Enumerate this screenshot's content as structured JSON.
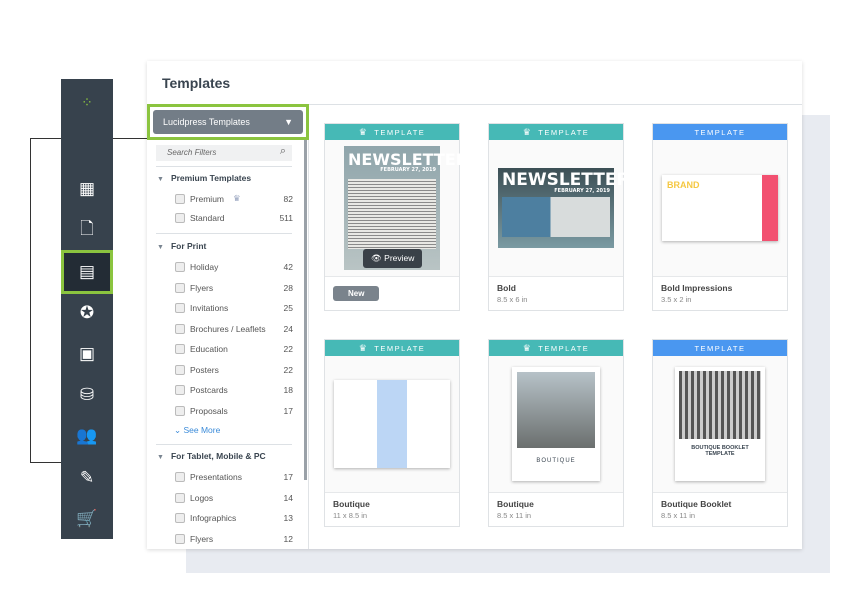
{
  "header": {
    "title": "Templates"
  },
  "dropdown": {
    "value": "Lucidpress Templates"
  },
  "search": {
    "placeholder": "Search Filters"
  },
  "sidebar": {
    "icons": [
      "logo-icon",
      "dashboard-icon",
      "document-icon",
      "templates-icon",
      "star-icon",
      "image-icon",
      "database-icon",
      "users-icon",
      "user-edit-icon",
      "cart-icon"
    ],
    "active": "templates-icon"
  },
  "filters": {
    "premium": {
      "title": "Premium Templates",
      "items": [
        {
          "label": "Premium",
          "count": "82"
        },
        {
          "label": "Standard",
          "count": "511"
        }
      ]
    },
    "print": {
      "title": "For Print",
      "items": [
        {
          "label": "Holiday",
          "count": "42"
        },
        {
          "label": "Flyers",
          "count": "28"
        },
        {
          "label": "Invitations",
          "count": "25"
        },
        {
          "label": "Brochures / Leaflets",
          "count": "24"
        },
        {
          "label": "Education",
          "count": "22"
        },
        {
          "label": "Posters",
          "count": "22"
        },
        {
          "label": "Postcards",
          "count": "18"
        },
        {
          "label": "Proposals",
          "count": "17"
        }
      ],
      "see_more": "See More"
    },
    "tablet": {
      "title": "For Tablet, Mobile & PC",
      "items": [
        {
          "label": "Presentations",
          "count": "17"
        },
        {
          "label": "Logos",
          "count": "14"
        },
        {
          "label": "Infographics",
          "count": "13"
        },
        {
          "label": "Flyers",
          "count": "12"
        }
      ]
    }
  },
  "cards": [
    {
      "band": "TEMPLATE",
      "premium": true,
      "badge": "New",
      "preview": "Preview",
      "thumb_title": "NEWSLETTER",
      "thumb_date": "FEBRUARY 27, 2019"
    },
    {
      "band": "TEMPLATE",
      "premium": true,
      "name": "Bold",
      "size": "8.5 x 6 in",
      "thumb_title": "NEWSLETTER",
      "thumb_date": "FEBRUARY 27, 2019"
    },
    {
      "band": "TEMPLATE",
      "premium": false,
      "name": "Bold Impressions",
      "size": "3.5 x 2 in",
      "thumb_title": "BRAND"
    },
    {
      "band": "TEMPLATE",
      "premium": true,
      "name": "Boutique",
      "size": "11 x 8.5 in"
    },
    {
      "band": "TEMPLATE",
      "premium": true,
      "name": "Boutique",
      "size": "8.5 x 11 in",
      "thumb_title": "BOUTIQUE"
    },
    {
      "band": "TEMPLATE",
      "premium": false,
      "name": "Boutique Booklet",
      "size": "8.5 x 11 in",
      "thumb_title": "BOUTIQUE BOOKLET TEMPLATE"
    }
  ],
  "colors": {
    "accent": "#8bc43f",
    "sidebar": "#37424d",
    "teal": "#46b9b6",
    "blue": "#4a97f0"
  }
}
